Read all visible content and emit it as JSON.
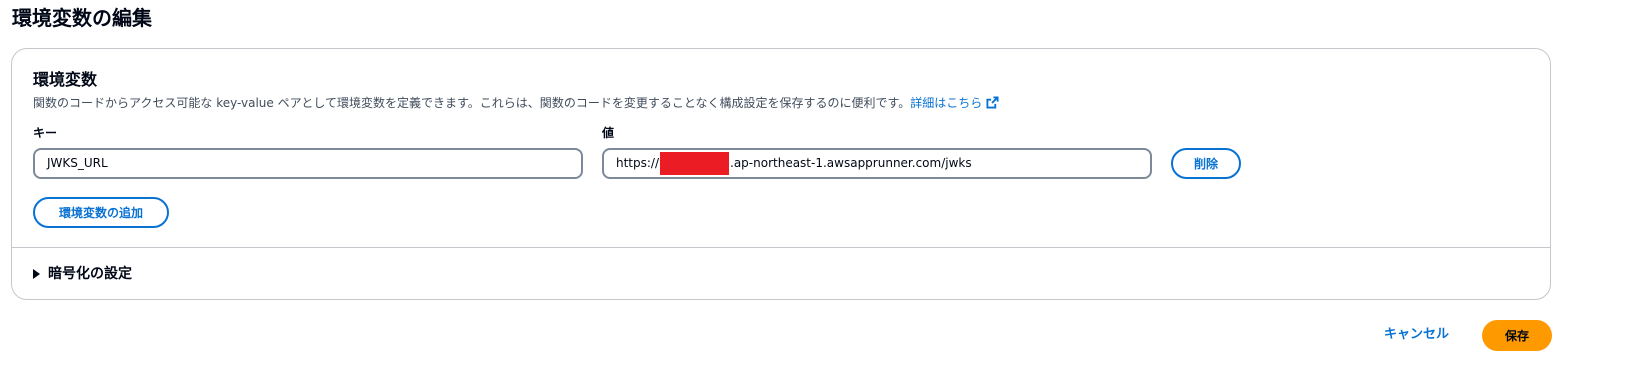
{
  "page": {
    "title": "環境変数の編集"
  },
  "env_section": {
    "title": "環境変数",
    "description": "関数のコードからアクセス可能な key-value ペアとして環境変数を定義できます。これらは、関数のコードを変更することなく構成設定を保存するのに便利です。",
    "learn_more_label": "詳細はこちら",
    "key_label": "キー",
    "value_label": "値",
    "variables": [
      {
        "key": "JWKS_URL",
        "value_prefix": "https://",
        "value_suffix": ".ap-northeast-1.awsapprunner.com/jwks",
        "remove_label": "削除"
      }
    ],
    "add_label": "環境変数の追加"
  },
  "encryption": {
    "label": "暗号化の設定"
  },
  "footer": {
    "cancel_label": "キャンセル",
    "save_label": "保存"
  },
  "colors": {
    "link": "#0972d3",
    "primary": "#ff9900",
    "redaction": "#ec1c24"
  },
  "icons": {
    "external_link": "external-link-icon",
    "expander": "caret-right-icon"
  }
}
